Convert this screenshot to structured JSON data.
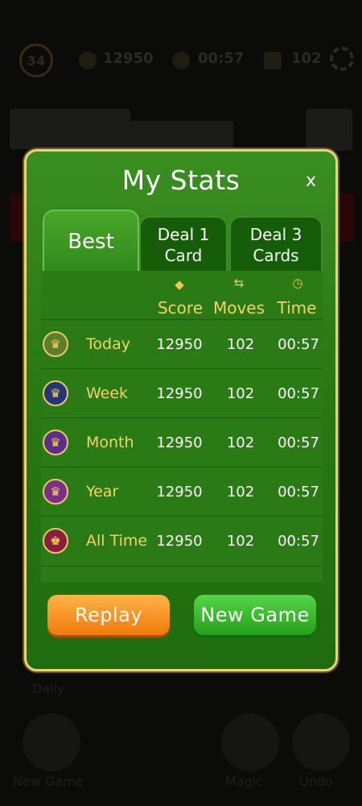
{
  "background": {
    "level": "34",
    "score": "12950",
    "timer": "00:57",
    "moves": "102",
    "bottom_labels": [
      "New Game",
      "Magic",
      "Undo"
    ],
    "daily_label": "Daily"
  },
  "dialog": {
    "title": "My Stats",
    "close_label": "x",
    "tabs": [
      {
        "label": "Best"
      },
      {
        "label_line1": "Deal 1",
        "label_line2": "Card"
      },
      {
        "label_line1": "Deal 3",
        "label_line2": "Cards"
      }
    ],
    "columns": [
      {
        "label": "Score",
        "icon": "diamond-icon"
      },
      {
        "label": "Moves",
        "icon": "arrows-swap-icon"
      },
      {
        "label": "Time",
        "icon": "clock-icon"
      }
    ],
    "rows": [
      {
        "label": "Today",
        "score": "12950",
        "moves": "102",
        "time": "00:57",
        "medal_color": "#5f7d2c"
      },
      {
        "label": "Week",
        "score": "12950",
        "moves": "102",
        "time": "00:57",
        "medal_color": "#24357a"
      },
      {
        "label": "Month",
        "score": "12950",
        "moves": "102",
        "time": "00:57",
        "medal_color": "#5a2e8a"
      },
      {
        "label": "Year",
        "score": "12950",
        "moves": "102",
        "time": "00:57",
        "medal_color": "#7d2e8a"
      },
      {
        "label": "All Time",
        "score": "12950",
        "moves": "102",
        "time": "00:57",
        "medal_color": "#8a1f3c"
      }
    ],
    "replay_label": "Replay",
    "new_game_label": "New Game"
  },
  "colors": {
    "gold_text": "#f1d36a",
    "panel_green": "#2a7a15",
    "border_gold": "#e9d47a",
    "replay_orange": "#f07a0a",
    "new_game_green": "#24a018"
  }
}
